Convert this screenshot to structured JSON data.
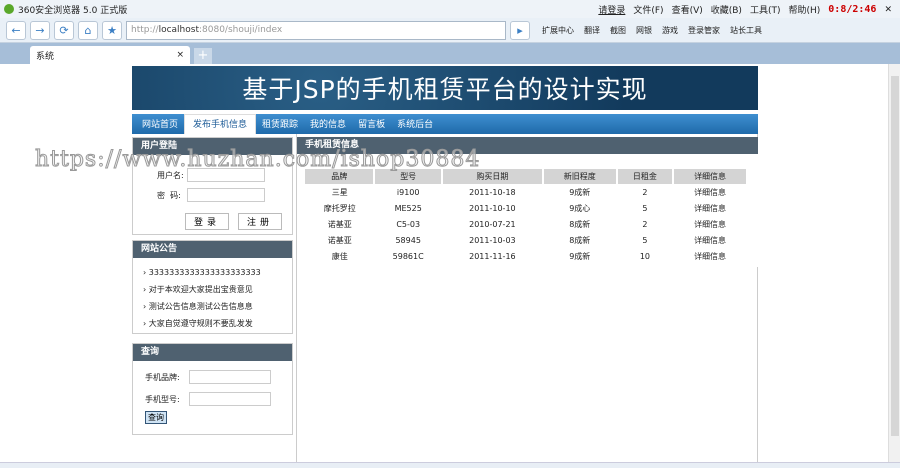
{
  "browser": {
    "title": "360安全浏览器 5.0 正式版",
    "login": "请登录",
    "menus": [
      "文件(F)",
      "查看(V)",
      "收藏(B)",
      "工具(T)",
      "帮助(H)"
    ],
    "recorder": "0:8/2:46",
    "url_prefix": "http://",
    "url_host": "localhost",
    "url_rest": ":8080/shouji/index",
    "tools": [
      "扩展中心",
      "翻译",
      "截图",
      "网银",
      "游戏",
      "登录管家",
      "站长工具"
    ],
    "tab_label": "系统"
  },
  "site": {
    "title": "基于JSP的手机租赁平台的设计实现",
    "nav": [
      "网站首页",
      "发布手机信息",
      "租赁跟踪",
      "我的信息",
      "留言板",
      "系统后台"
    ]
  },
  "login": {
    "title": "用户登陆",
    "username_label": "用户名:",
    "password_label": "密  码:",
    "login_btn": "登录",
    "register_btn": "注册"
  },
  "notice": {
    "title": "网站公告",
    "items": [
      "3333333333333333333333",
      "对于本欢迎大家提出宝贵意见",
      "测试公告信息测试公告信息息",
      "大家自觉遵守规则不要乱发发"
    ]
  },
  "search": {
    "title": "查询",
    "brand_label": "手机品牌:",
    "model_label": "手机型号:",
    "btn": "查询"
  },
  "listing": {
    "title": "手机租赁信息",
    "columns": [
      "品牌",
      "型号",
      "购买日期",
      "新旧程度",
      "日租金",
      "详细信息"
    ],
    "rows": [
      [
        "三星",
        "i9100",
        "2011-10-18",
        "9成新",
        "2",
        "详细信息"
      ],
      [
        "摩托罗拉",
        "ME525",
        "2011-10-10",
        "9成心",
        "5",
        "详细信息"
      ],
      [
        "诺基亚",
        "C5-03",
        "2010-07-21",
        "8成新",
        "2",
        "详细信息"
      ],
      [
        "诺基亚",
        "58945",
        "2011-10-03",
        "8成新",
        "5",
        "详细信息"
      ],
      [
        "康佳",
        "59861C",
        "2011-11-16",
        "9成新",
        "10",
        "详细信息"
      ]
    ]
  },
  "watermark": "https://www.huzhan.com/ishop30884"
}
